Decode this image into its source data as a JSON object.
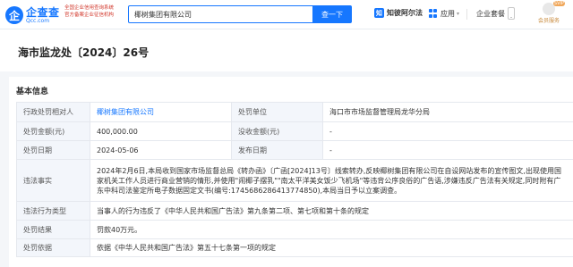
{
  "header": {
    "logo_mark": "企",
    "logo_cn": "企查查",
    "logo_en": "Qcc.com",
    "slogan_line1": "全国企业信用查询系统",
    "slogan_line2": "官方备案企业征信机构",
    "search_value": "椰树集团有限公司",
    "search_button": "查一下",
    "zhixiao_icon": "知",
    "zhixiao_label": "知彼阿尔法",
    "apps_label": "应用",
    "apps_caret": "▾",
    "kefu_label": "企业套餐",
    "vip_label": "会员服务"
  },
  "page": {
    "title": "海市监龙处〔2024〕26号",
    "section_title": "基本信息"
  },
  "info": {
    "party_label": "行政处罚相对人",
    "party_value": "椰树集团有限公司",
    "unit_label": "处罚单位",
    "unit_value": "海口市市场监督管理局龙华分局",
    "amount_label": "处罚金额(元)",
    "amount_value": "400,000.00",
    "confiscation_label": "没收金额(元)",
    "confiscation_value": "-",
    "date_label": "处罚日期",
    "date_value": "2024-05-06",
    "publish_label": "发布日期",
    "publish_value": "-",
    "facts_label": "违法事实",
    "facts_value": "2024年2月6日,本局收到国家市场监督总局《转办函》〔广函[2024]13号〕线索转办,反映椰树集团有限公司在自设网站发布的宣传图文,出现使用国家机关工作人员进行商业营销的情形,并使用\"闹椰子摆乳\"\"南太平洋美女饭少飞机场\"等违背公序良俗的广告语,涉嫌违反广告法有关规定,同时附有广东中科司法鉴定所电子数据固定文书(编号:17456862864137748​50),本局当日予以立案调查。",
    "type_label": "违法行为类型",
    "type_value": "当事人的行为违反了《中华人民共和国广告法》第九条第二项、第七项和第十条的规定",
    "result_label": "处罚结果",
    "result_value": "罚款40万元。",
    "basis_label": "处罚依据",
    "basis_value": "依据《中华人民共和国广告法》第五十七条第一项的规定"
  }
}
